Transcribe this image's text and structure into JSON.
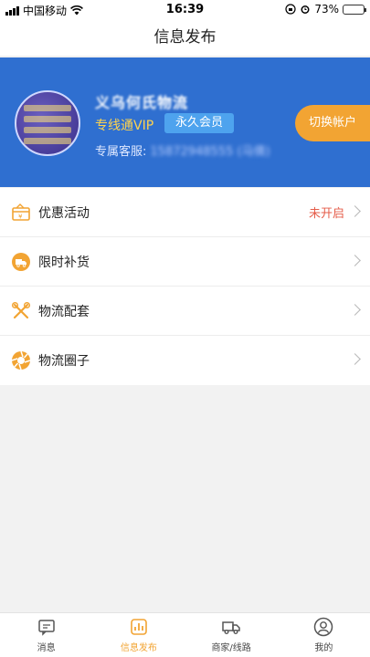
{
  "status_bar": {
    "carrier": "中国移动",
    "time": "16:39",
    "battery": "73%",
    "battery_level": 0.73
  },
  "nav": {
    "title": "信息发布"
  },
  "profile": {
    "company_name": "义乌何氏物流",
    "vip_label": "专线通VIP",
    "member_badge": "永久会员",
    "service_label": "专属客服:",
    "service_phone": "15872948555 (马倩)",
    "switch_button": "切换帐户"
  },
  "menu": {
    "items": [
      {
        "label": "优惠活动",
        "status": "未开启",
        "icon": "coupon-icon"
      },
      {
        "label": "限时补货",
        "status": "",
        "icon": "delivery-truck-icon"
      },
      {
        "label": "物流配套",
        "status": "",
        "icon": "tools-icon"
      },
      {
        "label": "物流圈子",
        "status": "",
        "icon": "aperture-icon"
      }
    ]
  },
  "tabs": [
    {
      "label": "消息",
      "icon": "message-icon",
      "active": false
    },
    {
      "label": "信息发布",
      "icon": "publish-icon",
      "active": true
    },
    {
      "label": "商家/线路",
      "icon": "truck-icon",
      "active": false
    },
    {
      "label": "我的",
      "icon": "user-icon",
      "active": false
    }
  ],
  "colors": {
    "banner_blue": "#2f6fd0",
    "accent_orange": "#f2a433",
    "vip_gold": "#ffd34d",
    "badge_blue": "#4ea3ee",
    "status_red": "#e55d4a"
  }
}
